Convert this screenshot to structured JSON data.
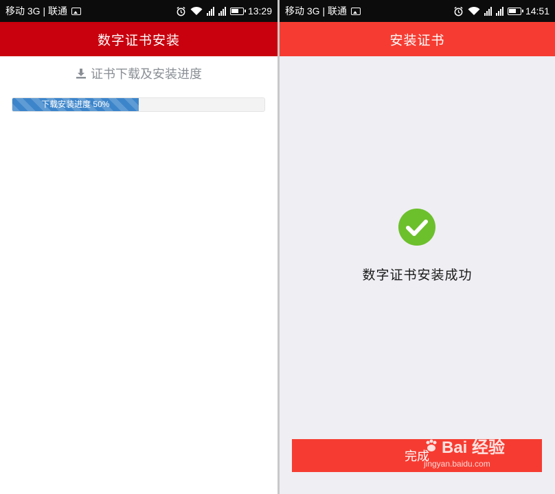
{
  "left_screen": {
    "status_bar": {
      "carrier": "移动 3G | 联通",
      "time": "13:29"
    },
    "title": "数字证书安装",
    "section_title": "证书下载及安装进度",
    "progress": {
      "label": "下载安装进度 50%",
      "value_percent": 50
    }
  },
  "right_screen": {
    "status_bar": {
      "carrier": "移动 3G | 联通",
      "time": "14:51"
    },
    "title": "安装证书",
    "success_message": "数字证书安装成功",
    "done_label": "完成"
  },
  "watermark": {
    "brand": "Bai 经验",
    "url": "jingyan.baidu.com"
  },
  "colors": {
    "left_title_bg": "#c9000d",
    "right_title_bg": "#f63c32",
    "progress_fill": "#3c85cb",
    "success_green": "#6cc02c",
    "button_red": "#f63c32"
  },
  "icons": [
    "image-icon",
    "alarm-icon",
    "wifi-icon",
    "signal-icon",
    "battery-icon",
    "download-icon",
    "check-circle-icon",
    "paw-icon"
  ]
}
